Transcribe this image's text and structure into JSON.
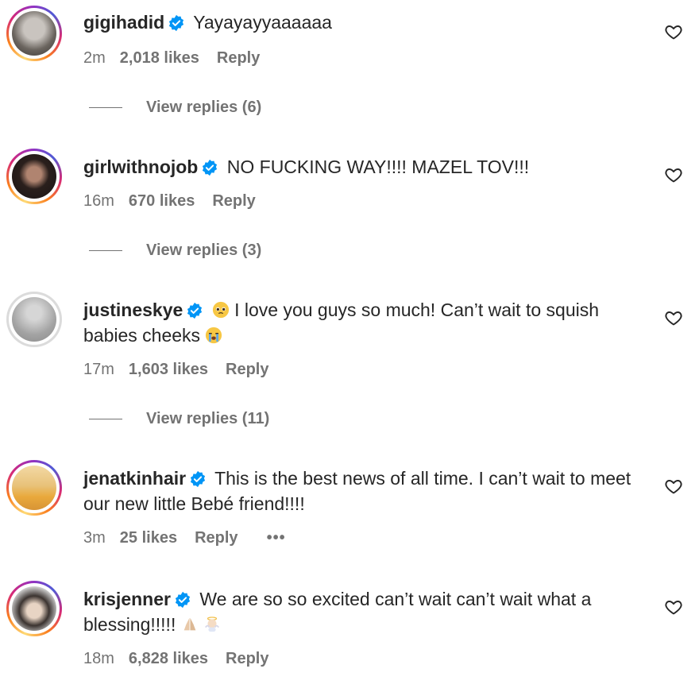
{
  "comments": [
    {
      "username": "gigihadid",
      "text": "Yayayayyaaaaaa",
      "time": "2m",
      "likes": "2,018 likes",
      "reply": "Reply",
      "view_replies": "View replies (6)"
    },
    {
      "username": "girlwithnojob",
      "text": "NO FUCKING WAY!!!! MAZEL TOV!!!",
      "time": "16m",
      "likes": "670 likes",
      "reply": "Reply",
      "view_replies": "View replies (3)"
    },
    {
      "username": "justineskye",
      "text_before": "I love you guys so much! Can’t wait to squish babies cheeks",
      "time": "17m",
      "likes": "1,603 likes",
      "reply": "Reply",
      "view_replies": "View replies (11)"
    },
    {
      "username": "jenatkinhair",
      "text": "This is the best news of all time. I can’t wait to meet our new little Bebé friend!!!!",
      "time": "3m",
      "likes": "25 likes",
      "reply": "Reply",
      "more": "•••"
    },
    {
      "username": "krisjenner",
      "text": "We are so so excited can’t wait can’t wait what a blessing!!!!!",
      "time": "18m",
      "likes": "6,828 likes",
      "reply": "Reply"
    }
  ],
  "icons": {
    "verified": "verified-badge-icon",
    "heart": "heart-outline-icon",
    "emoji_teary": "pleading-face-emoji",
    "emoji_crying": "loudly-crying-emoji",
    "emoji_pray": "folded-hands-emoji",
    "emoji_baby": "baby-angel-emoji"
  },
  "colors": {
    "text": "#262626",
    "secondary": "#737373",
    "verified": "#0095f6"
  }
}
